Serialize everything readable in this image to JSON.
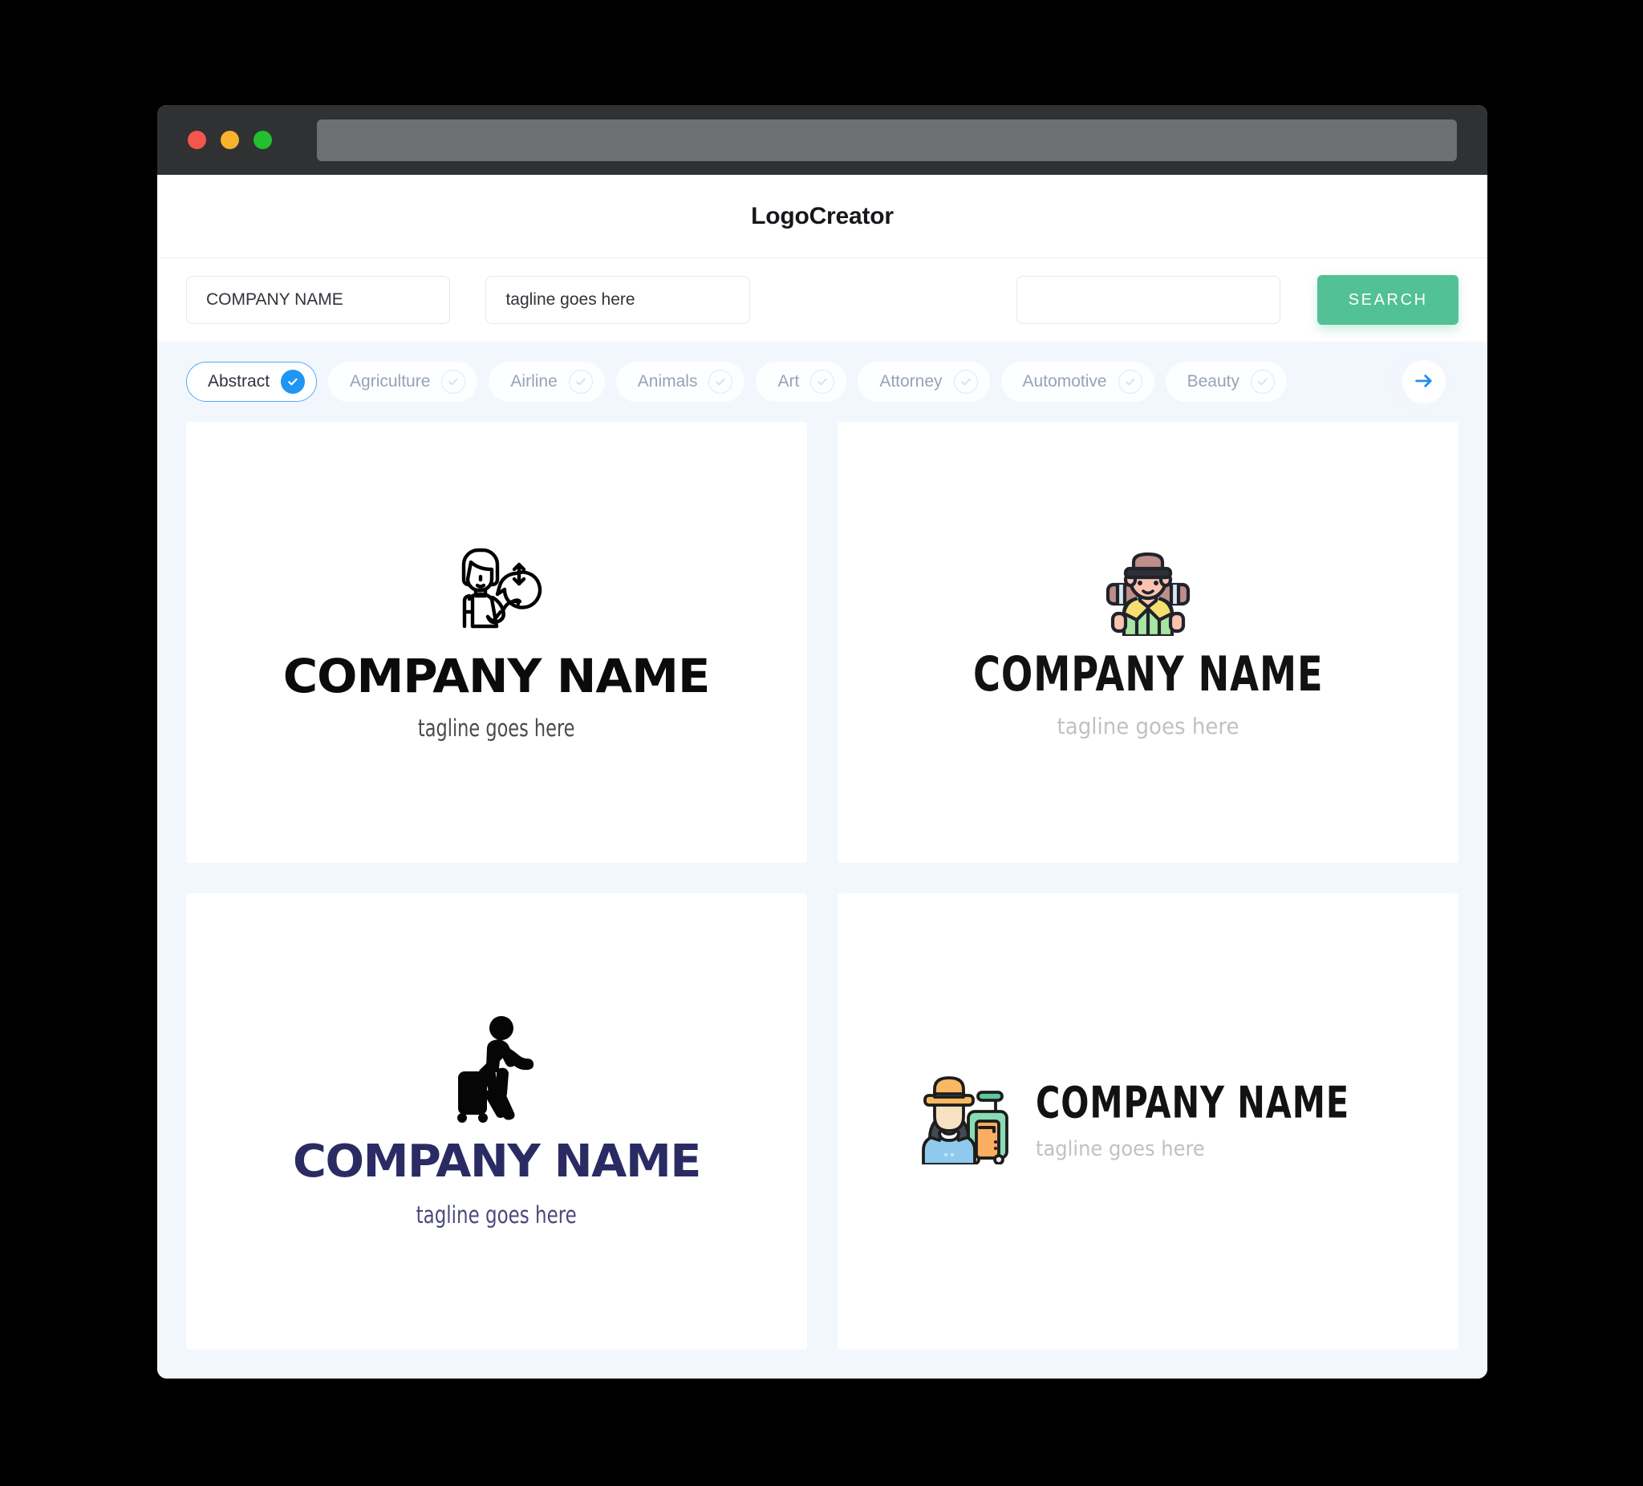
{
  "window": {
    "traffic_lights": [
      "close-red",
      "minimize-amber",
      "maximize-green"
    ],
    "colors": {
      "chrome": "#2F3133",
      "address_bar": "#6E6F70",
      "red": "#F4564C",
      "amber": "#F6B32B",
      "green": "#22C02E",
      "page_bg": "#F2F6FD",
      "accent_green": "#52C195",
      "accent_blue": "#1E96F2",
      "navy": "#2B2B64"
    }
  },
  "header": {
    "title": "LogoCreator"
  },
  "search": {
    "company_name": {
      "value": "COMPANY NAME",
      "placeholder": "COMPANY NAME"
    },
    "tagline": {
      "value": "tagline goes here",
      "placeholder": "tagline goes here"
    },
    "keyword": {
      "value": "",
      "placeholder": ""
    },
    "button_label": "SEARCH"
  },
  "categories": {
    "next_icon": "arrow-right-icon",
    "items": [
      {
        "label": "Abstract",
        "selected": true
      },
      {
        "label": "Agriculture",
        "selected": false
      },
      {
        "label": "Airline",
        "selected": false
      },
      {
        "label": "Animals",
        "selected": false
      },
      {
        "label": "Art",
        "selected": false
      },
      {
        "label": "Attorney",
        "selected": false
      },
      {
        "label": "Automotive",
        "selected": false
      },
      {
        "label": "Beauty",
        "selected": false
      }
    ]
  },
  "results": {
    "logos": [
      {
        "id": "logo-1",
        "icon": "woman-presenter-speech-bubble-icon",
        "layout": "stacked",
        "title": "COMPANY NAME",
        "tagline": "tagline goes here",
        "title_color": "#0B0B0B",
        "tagline_color": "#4B4B4B"
      },
      {
        "id": "logo-2",
        "icon": "hiker-backpacker-icon",
        "layout": "stacked",
        "title": "COMPANY NAME",
        "tagline": "tagline goes here",
        "title_color": "#121212",
        "tagline_color": "#BFC1C4"
      },
      {
        "id": "logo-3",
        "icon": "traveler-rolling-luggage-silhouette-icon",
        "layout": "stacked",
        "title": "COMPANY NAME",
        "tagline": "tagline goes here",
        "title_color": "#2B2B64",
        "tagline_color": "#4A4A7E"
      },
      {
        "id": "logo-4",
        "icon": "woman-traveler-suitcase-icon",
        "layout": "inline",
        "title": "COMPANY NAME",
        "tagline": "tagline goes here",
        "title_color": "#121212",
        "tagline_color": "#BFC1C4"
      }
    ]
  }
}
